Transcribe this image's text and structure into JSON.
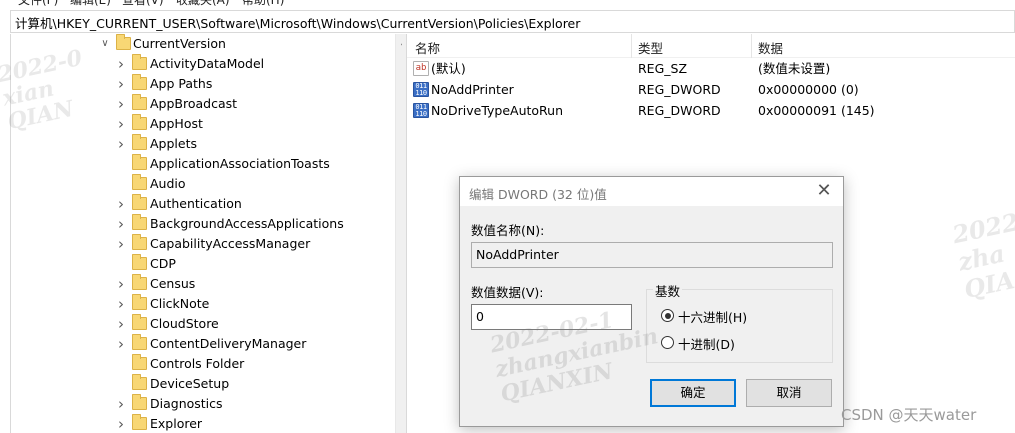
{
  "menubar": {
    "items": [
      "文件(F)",
      "编辑(E)",
      "查看(V)",
      "收藏夹(A)",
      "帮助(H)"
    ]
  },
  "address": {
    "path": "计算机\\HKEY_CURRENT_USER\\Software\\Microsoft\\Windows\\CurrentVersion\\Policies\\Explorer"
  },
  "tree": {
    "parent": "CurrentVersion",
    "children": [
      {
        "label": "ActivityDataModel",
        "expandable": true
      },
      {
        "label": "App Paths",
        "expandable": true
      },
      {
        "label": "AppBroadcast",
        "expandable": true
      },
      {
        "label": "AppHost",
        "expandable": true
      },
      {
        "label": "Applets",
        "expandable": true
      },
      {
        "label": "ApplicationAssociationToasts",
        "expandable": false
      },
      {
        "label": "Audio",
        "expandable": false
      },
      {
        "label": "Authentication",
        "expandable": true
      },
      {
        "label": "BackgroundAccessApplications",
        "expandable": true
      },
      {
        "label": "CapabilityAccessManager",
        "expandable": true
      },
      {
        "label": "CDP",
        "expandable": false
      },
      {
        "label": "Census",
        "expandable": true
      },
      {
        "label": "ClickNote",
        "expandable": true
      },
      {
        "label": "CloudStore",
        "expandable": true
      },
      {
        "label": "ContentDeliveryManager",
        "expandable": true
      },
      {
        "label": "Controls Folder",
        "expandable": false
      },
      {
        "label": "DeviceSetup",
        "expandable": false
      },
      {
        "label": "Diagnostics",
        "expandable": true
      },
      {
        "label": "Explorer",
        "expandable": true
      }
    ]
  },
  "list": {
    "headers": {
      "name": "名称",
      "type": "类型",
      "data": "数据"
    },
    "rows": [
      {
        "icon": "string-value-icon",
        "icon_glyph": "ab",
        "name": "(默认)",
        "type": "REG_SZ",
        "data": "(数值未设置)"
      },
      {
        "icon": "dword-value-icon",
        "icon_glyph": "011 110",
        "name": "NoAddPrinter",
        "type": "REG_DWORD",
        "data": "0x00000000 (0)"
      },
      {
        "icon": "dword-value-icon",
        "icon_glyph": "011 110",
        "name": "NoDriveTypeAutoRun",
        "type": "REG_DWORD",
        "data": "0x00000091 (145)"
      }
    ]
  },
  "dialog": {
    "title": "编辑 DWORD (32 位)值",
    "close_glyph": "✕",
    "value_name_label": "数值名称(N):",
    "value_name": "NoAddPrinter",
    "value_data_label": "数值数据(V):",
    "value_data": "0",
    "base_label": "基数",
    "radio_hex": "十六进制(H)",
    "radio_dec": "十进制(D)",
    "base_selected": "hex",
    "ok_label": "确定",
    "cancel_label": "取消"
  },
  "watermarks": {
    "a_line1": "2022-02-1",
    "a_line2": "zhangxianbin",
    "a_line3": "QIANXIN",
    "b_line1": "2022",
    "b_line2": "zha",
    "b_line3": "QIA",
    "c_line1": "2022-0",
    "c_line2": "xian",
    "c_line3": "QIAN"
  },
  "attribution": "CSDN @天天water",
  "colors": {
    "folder": "#f8d775",
    "accent": "#0078d7",
    "dialog_bg": "#f0f0f0"
  }
}
